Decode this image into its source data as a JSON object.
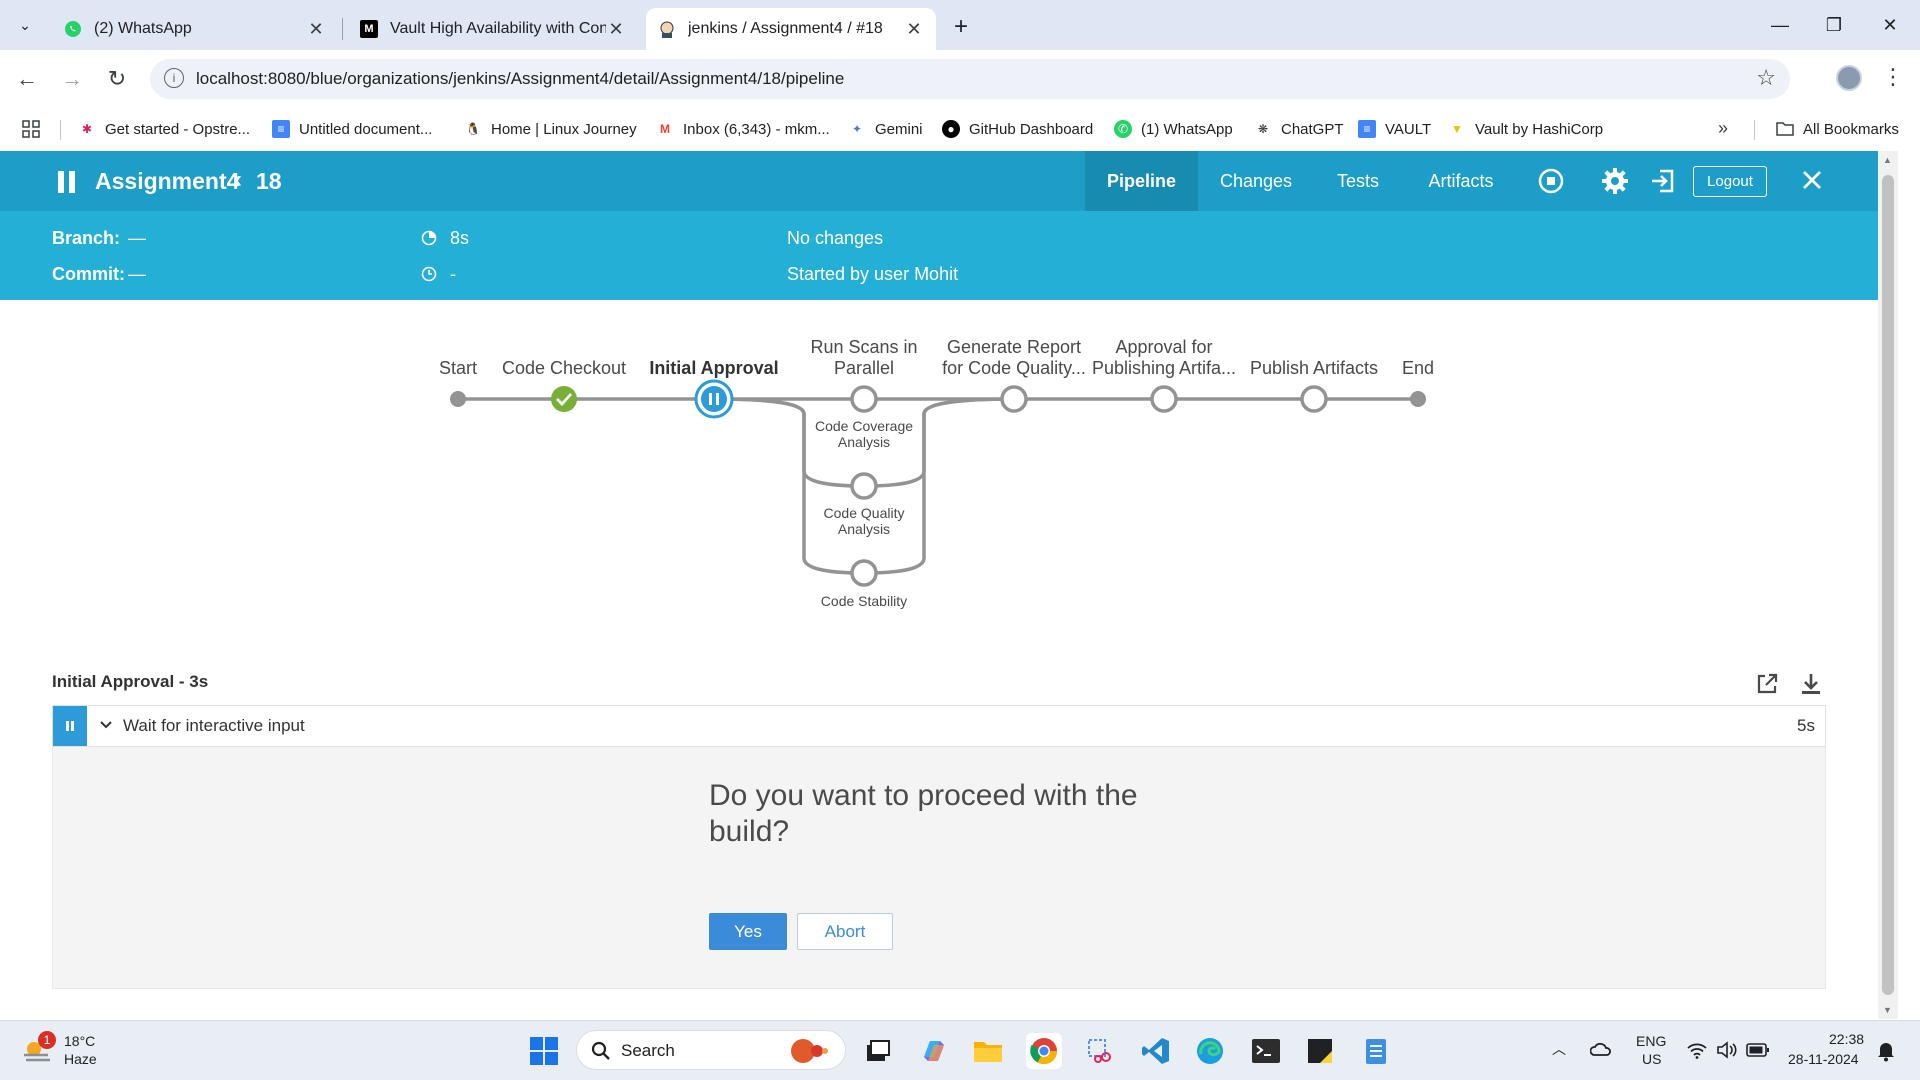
{
  "browser": {
    "tabs": [
      {
        "title": "(2) WhatsApp",
        "icon": "whatsapp-icon"
      },
      {
        "title": "Vault High Availability with Con",
        "icon": "medium-icon"
      },
      {
        "title": "jenkins / Assignment4 / #18",
        "icon": "jenkins-icon"
      }
    ],
    "url": "localhost:8080/blue/organizations/jenkins/Assignment4/detail/Assignment4/18/pipeline",
    "bookmarks": [
      {
        "label": "Get started - Opstre...",
        "icon": "slack-icon"
      },
      {
        "label": "Untitled document...",
        "icon": "docs-icon"
      },
      {
        "label": "Home | Linux Journey",
        "icon": "linux-icon"
      },
      {
        "label": "Inbox (6,343) - mkm...",
        "icon": "gmail-icon"
      },
      {
        "label": "Gemini",
        "icon": "gemini-icon"
      },
      {
        "label": "GitHub Dashboard",
        "icon": "github-icon"
      },
      {
        "label": "(1) WhatsApp",
        "icon": "whatsapp-icon"
      },
      {
        "label": "ChatGPT",
        "icon": "chatgpt-icon"
      },
      {
        "label": "VAULT",
        "icon": "docs-icon"
      },
      {
        "label": "Vault by HashiCorp",
        "icon": "vault-icon"
      }
    ],
    "all_bookmarks": "All Bookmarks"
  },
  "jenkins": {
    "job": "Assignment4",
    "run": "18",
    "nav": [
      "Pipeline",
      "Changes",
      "Tests",
      "Artifacts"
    ],
    "logout": "Logout",
    "branch_label": "Branch:",
    "branch_value": "—",
    "commit_label": "Commit:",
    "commit_value": "—",
    "duration": "8s",
    "time": "-",
    "changes": "No changes",
    "started_by": "Started by user Mohit",
    "colors": {
      "header": "#1d9ec8",
      "subheader": "#24b0d6",
      "success": "#78b037",
      "running": "#2d9bd8",
      "node": "#949393"
    }
  },
  "pipeline": {
    "stages": [
      {
        "label": "Start",
        "state": "start"
      },
      {
        "label": "Code Checkout",
        "state": "success"
      },
      {
        "label": "Initial Approval",
        "state": "paused"
      },
      {
        "label": "Run Scans in Parallel",
        "state": "pending"
      },
      {
        "label": "Generate Report for Code Quality...",
        "state": "pending"
      },
      {
        "label": "Approval for Publishing Artifa...",
        "state": "pending"
      },
      {
        "label": "Publish Artifacts",
        "state": "pending"
      },
      {
        "label": "End",
        "state": "end"
      }
    ],
    "parallel": [
      "Code Coverage Analysis",
      "Code Quality Analysis",
      "Code Stability"
    ]
  },
  "log": {
    "title": "Initial Approval - 3s",
    "step": "Wait for interactive input",
    "step_duration": "5s",
    "question": "Do you want to proceed with the build?",
    "yes": "Yes",
    "abort": "Abort"
  },
  "taskbar": {
    "weather_temp": "18°C",
    "weather_desc": "Haze",
    "weather_badge": "1",
    "search": "Search",
    "lang": "ENG",
    "region": "US",
    "time": "22:38",
    "date": "28-11-2024"
  }
}
